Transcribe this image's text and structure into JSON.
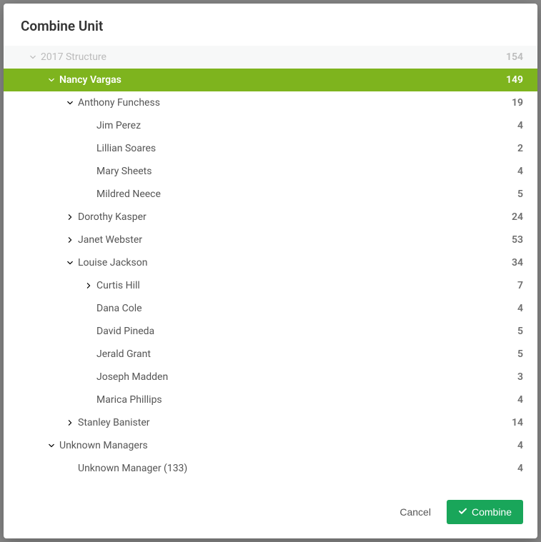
{
  "modal": {
    "title": "Combine Unit"
  },
  "tree": [
    {
      "label": "2017 Structure",
      "count": "154",
      "level": 0,
      "expanded": true,
      "hasChildren": true,
      "root": true,
      "selected": false
    },
    {
      "label": "Nancy Vargas",
      "count": "149",
      "level": 1,
      "expanded": true,
      "hasChildren": true,
      "root": false,
      "selected": true
    },
    {
      "label": "Anthony Funchess",
      "count": "19",
      "level": 2,
      "expanded": true,
      "hasChildren": true,
      "root": false,
      "selected": false
    },
    {
      "label": "Jim Perez",
      "count": "4",
      "level": 3,
      "expanded": false,
      "hasChildren": false,
      "root": false,
      "selected": false
    },
    {
      "label": "Lillian Soares",
      "count": "2",
      "level": 3,
      "expanded": false,
      "hasChildren": false,
      "root": false,
      "selected": false
    },
    {
      "label": "Mary Sheets",
      "count": "4",
      "level": 3,
      "expanded": false,
      "hasChildren": false,
      "root": false,
      "selected": false
    },
    {
      "label": "Mildred Neece",
      "count": "5",
      "level": 3,
      "expanded": false,
      "hasChildren": false,
      "root": false,
      "selected": false
    },
    {
      "label": "Dorothy Kasper",
      "count": "24",
      "level": 2,
      "expanded": false,
      "hasChildren": true,
      "root": false,
      "selected": false
    },
    {
      "label": "Janet Webster",
      "count": "53",
      "level": 2,
      "expanded": false,
      "hasChildren": true,
      "root": false,
      "selected": false
    },
    {
      "label": "Louise Jackson",
      "count": "34",
      "level": 2,
      "expanded": true,
      "hasChildren": true,
      "root": false,
      "selected": false
    },
    {
      "label": "Curtis Hill",
      "count": "7",
      "level": 3,
      "expanded": false,
      "hasChildren": true,
      "root": false,
      "selected": false
    },
    {
      "label": "Dana Cole",
      "count": "4",
      "level": 3,
      "expanded": false,
      "hasChildren": false,
      "root": false,
      "selected": false
    },
    {
      "label": "David Pineda",
      "count": "5",
      "level": 3,
      "expanded": false,
      "hasChildren": false,
      "root": false,
      "selected": false
    },
    {
      "label": "Jerald Grant",
      "count": "5",
      "level": 3,
      "expanded": false,
      "hasChildren": false,
      "root": false,
      "selected": false
    },
    {
      "label": "Joseph Madden",
      "count": "3",
      "level": 3,
      "expanded": false,
      "hasChildren": false,
      "root": false,
      "selected": false
    },
    {
      "label": "Marica Phillips",
      "count": "4",
      "level": 3,
      "expanded": false,
      "hasChildren": false,
      "root": false,
      "selected": false
    },
    {
      "label": "Stanley Banister",
      "count": "14",
      "level": 2,
      "expanded": false,
      "hasChildren": true,
      "root": false,
      "selected": false
    },
    {
      "label": "Unknown Managers",
      "count": "4",
      "level": 1,
      "expanded": true,
      "hasChildren": true,
      "root": false,
      "selected": false
    },
    {
      "label": "Unknown Manager (133)",
      "count": "4",
      "level": 2,
      "expanded": false,
      "hasChildren": false,
      "root": false,
      "selected": false
    }
  ],
  "footer": {
    "cancel_label": "Cancel",
    "combine_label": "Combine"
  },
  "indentBase": 36,
  "indentStep": 26
}
